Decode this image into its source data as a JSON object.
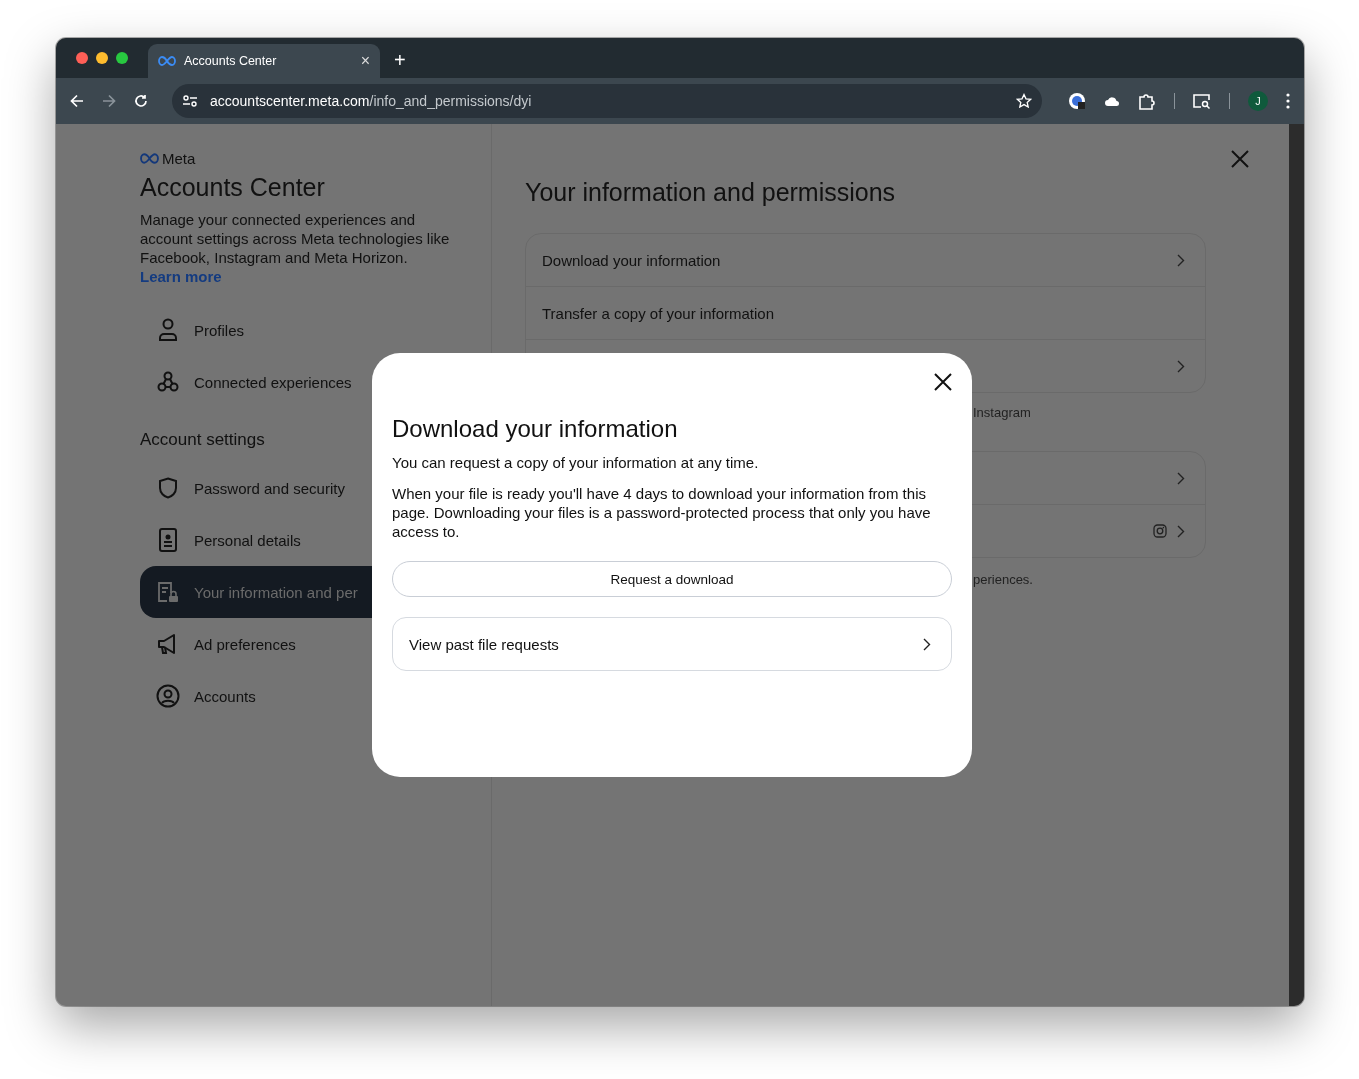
{
  "browser": {
    "tab_title": "Accounts Center",
    "tab_close": "×",
    "new_tab": "+",
    "url_host": "accountscenter.meta.com",
    "url_path": "/info_and_permissions/dyi",
    "avatar_letter": "J"
  },
  "sidebar": {
    "brand": "Meta",
    "title": "Accounts Center",
    "description": "Manage your connected experiences and account settings across Meta technologies like Facebook, Instagram and Meta Horizon.",
    "learn_more": "Learn more",
    "top_items": [
      {
        "label": "Profiles",
        "selected": false
      },
      {
        "label": "Connected experiences",
        "selected": false
      }
    ],
    "section_title": "Account settings",
    "items": [
      {
        "label": "Password and security",
        "selected": false
      },
      {
        "label": "Personal details",
        "selected": false
      },
      {
        "label": "Your information and per",
        "selected": true
      },
      {
        "label": "Ad preferences",
        "selected": false
      },
      {
        "label": "Accounts",
        "selected": false
      }
    ]
  },
  "main": {
    "title": "Your information and permissions",
    "card_1": [
      {
        "label": "Download your information",
        "chevron": true
      },
      {
        "label": "Transfer a copy of your information",
        "chevron": false
      },
      {
        "chevron": true
      }
    ],
    "caption_1": "Instagram",
    "card_2": [
      {
        "chevron": true,
        "app_icon": false
      },
      {
        "chevron": true,
        "app_icon": true
      }
    ],
    "caption_2": "periences."
  },
  "modal": {
    "title": "Download your information",
    "intro": "You can request a copy of your information at any time.",
    "body": "When your file is ready you'll have 4 days to download your information from this page. Downloading your files is a password-protected process that only you have access to.",
    "request_button": "Request a download",
    "past_requests": "View past file requests"
  }
}
